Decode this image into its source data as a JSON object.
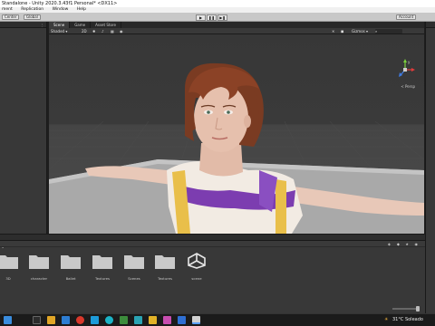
{
  "window": {
    "title": "Standalone - Unity 2020.3.43f1 Personal* <DX11>"
  },
  "menu": {
    "items": [
      "ment",
      "Replication",
      "Window",
      "Help"
    ]
  },
  "toolbar": {
    "center_label": "Center",
    "global_label": "Global",
    "account_label": "Account"
  },
  "scene_tabs": [
    "Scene",
    "Game",
    "Asset Store"
  ],
  "scene_toolbar": {
    "shading_mode": "Shaded",
    "mode_2d": "2D",
    "gizmos": "Gizmos",
    "gizmo_persp": "< Persp"
  },
  "project": {
    "folders": [
      {
        "label": "3D"
      },
      {
        "label": "character"
      },
      {
        "label": "Ballet"
      },
      {
        "label": "Textures"
      },
      {
        "label": "Scenes"
      },
      {
        "label": "Textures"
      },
      {
        "label": "scene"
      }
    ]
  },
  "taskbar": {
    "temperature": "31°C Soleado"
  },
  "colors": {
    "editor_bg": "#383838",
    "folder": "#c9c9c9",
    "gizmo_x": "#e33b3b",
    "gizmo_y": "#7bd13c",
    "gizmo_z": "#3f7be3"
  }
}
